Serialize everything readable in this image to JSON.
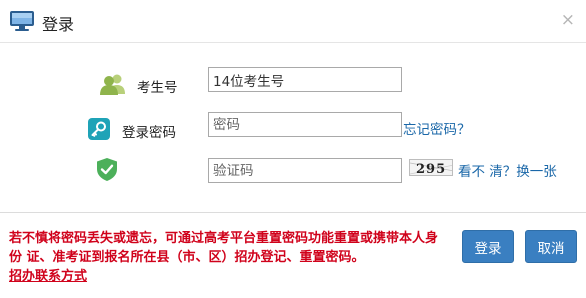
{
  "header": {
    "title": "登录",
    "close_label": "×"
  },
  "form": {
    "exam_no": {
      "label": "考生号",
      "value": "14位考生号"
    },
    "password": {
      "label": "登录密码",
      "placeholder": "密码",
      "forgot_link": "忘记密码？"
    },
    "captcha": {
      "placeholder": "验证码",
      "image_text": "295",
      "refresh_link": "看不 清？换一张"
    }
  },
  "notice": {
    "text": "若不慎将密码丢失或遗忘，可通过高考平台重置密码功能重置或携带本人身份 证、准考证到报名所在县（市、区）招办登记、重置密码。",
    "link": "招办联系方式"
  },
  "buttons": {
    "login": "登录",
    "cancel": "取消"
  },
  "colors": {
    "primary_button": "#3a7fc1",
    "link": "#1a67a8",
    "notice": "#d0021b",
    "user_icon": "#9bbf5a",
    "key_icon": "#1fa3b7",
    "shield_icon": "#4cb05a"
  }
}
